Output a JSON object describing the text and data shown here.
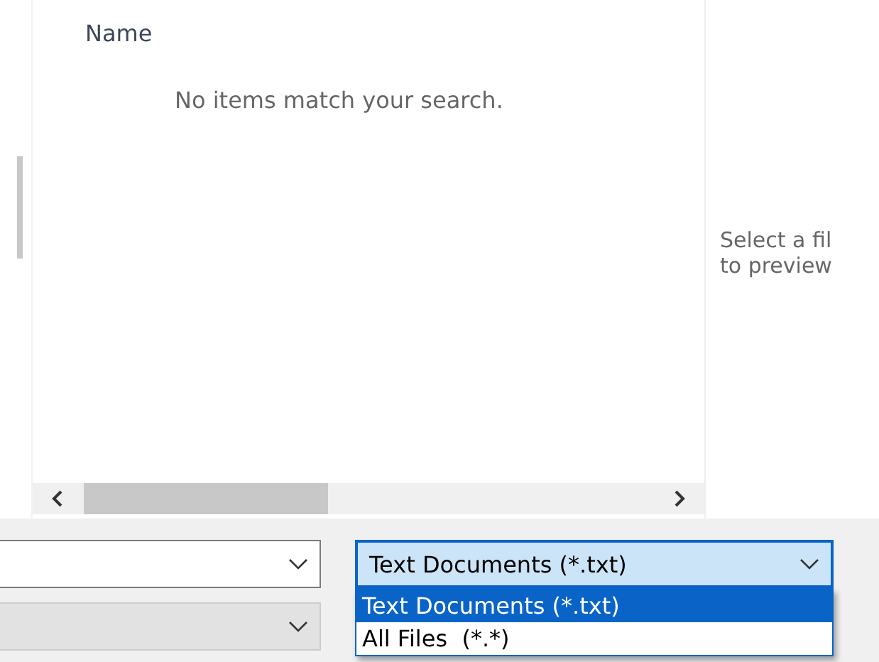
{
  "file_list": {
    "columns": [
      {
        "label": "Name"
      }
    ],
    "empty_message": "No items match your search."
  },
  "preview": {
    "lines": [
      "Select a fil",
      "to preview"
    ]
  },
  "left_fields": [
    {
      "kind": "combo",
      "disabled": false
    },
    {
      "kind": "combo",
      "disabled": true
    }
  ],
  "file_type": {
    "value": "Text Documents (*.txt)",
    "expanded": true,
    "options": [
      {
        "label": "Text Documents (*.txt)",
        "selected": true
      },
      {
        "label": "All Files  (*.*)",
        "selected": false
      }
    ]
  }
}
